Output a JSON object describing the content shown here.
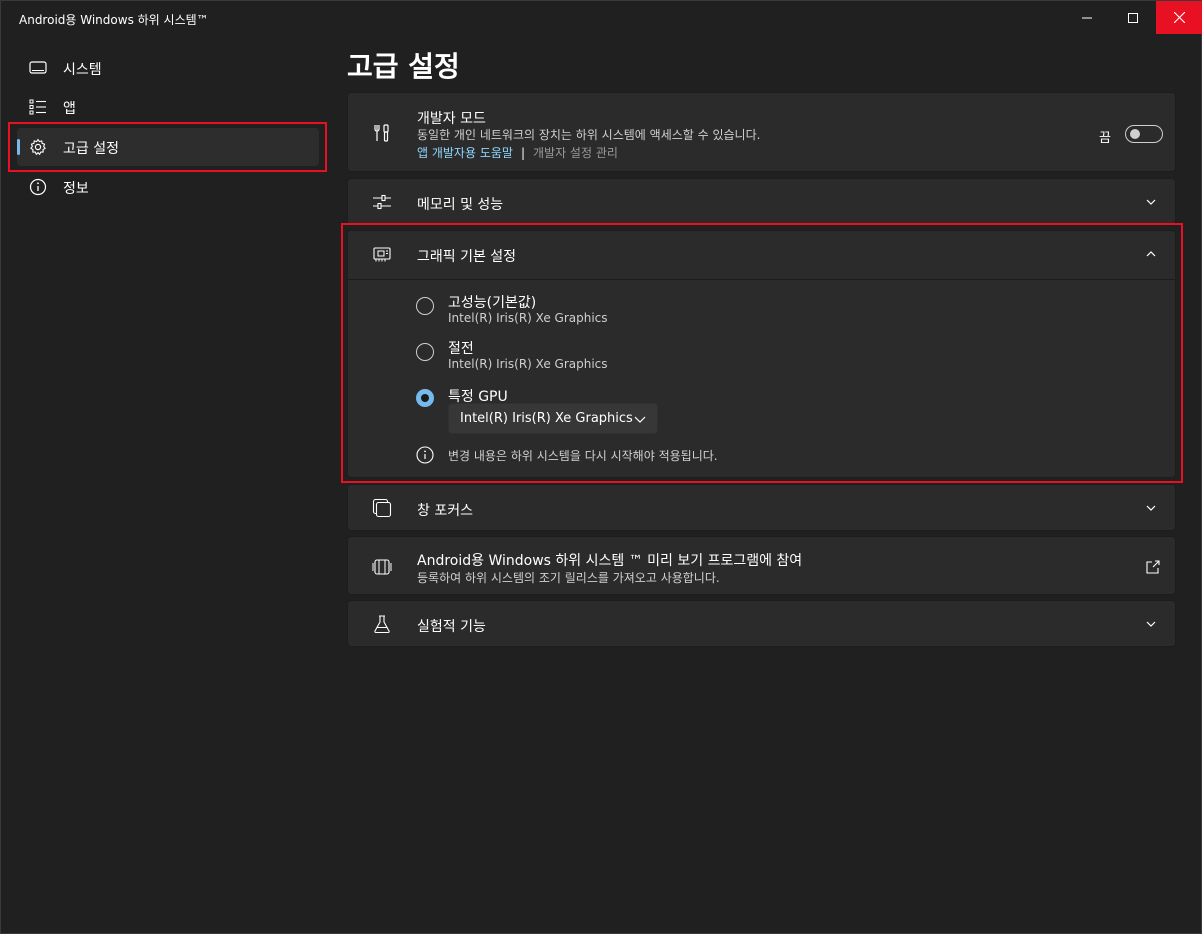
{
  "window": {
    "title": "Android용 Windows 하위 시스템™",
    "minimize_icon": "minimize-icon",
    "maximize_icon": "maximize-icon",
    "close_icon": "close-icon",
    "close_color": "#e81123"
  },
  "sidebar": {
    "items": [
      {
        "label": "시스템",
        "icon": "monitor-icon",
        "selected": false
      },
      {
        "label": "앱",
        "icon": "list-icon",
        "selected": false
      },
      {
        "label": "고급 설정",
        "icon": "gear-icon",
        "selected": true
      },
      {
        "label": "정보",
        "icon": "info-icon",
        "selected": false
      }
    ],
    "accent": "#76b9ed"
  },
  "page": {
    "title": "고급 설정"
  },
  "developer_mode": {
    "title": "개발자 모드",
    "description": "동일한 개인 네트워크의 장치는 하위 시스템에 액세스할 수 있습니다.",
    "help_link": "앱 개발자용 도움말",
    "separator": "|",
    "manage_link": "개발자 설정 관리",
    "toggle_label": "끔",
    "toggle_on": false
  },
  "memory": {
    "title": "메모리 및 성능"
  },
  "graphics": {
    "title": "그래픽 기본 설정",
    "expanded": true,
    "options": [
      {
        "label": "고성능(기본값)",
        "sub": "Intel(R) Iris(R) Xe Graphics",
        "checked": false
      },
      {
        "label": "절전",
        "sub": "Intel(R) Iris(R) Xe Graphics",
        "checked": false
      },
      {
        "label": "특정 GPU",
        "checked": true
      }
    ],
    "gpu_dropdown_value": "Intel(R) Iris(R) Xe Graphics",
    "note": "변경 내용은 하위 시스템을 다시 시작해야 적용됩니다."
  },
  "focus": {
    "title": "창 포커스"
  },
  "preview": {
    "title": "Android용 Windows 하위 시스템 ™ 미리 보기 프로그램에 참여",
    "description": "등록하여 하위 시스템의 조기 릴리스를 가져오고 사용합니다."
  },
  "experimental": {
    "title": "실험적 기능"
  },
  "colors": {
    "background": "#202020",
    "card": "#2b2b2b",
    "highlight": "#e81123",
    "link": "#8fd8ff"
  }
}
